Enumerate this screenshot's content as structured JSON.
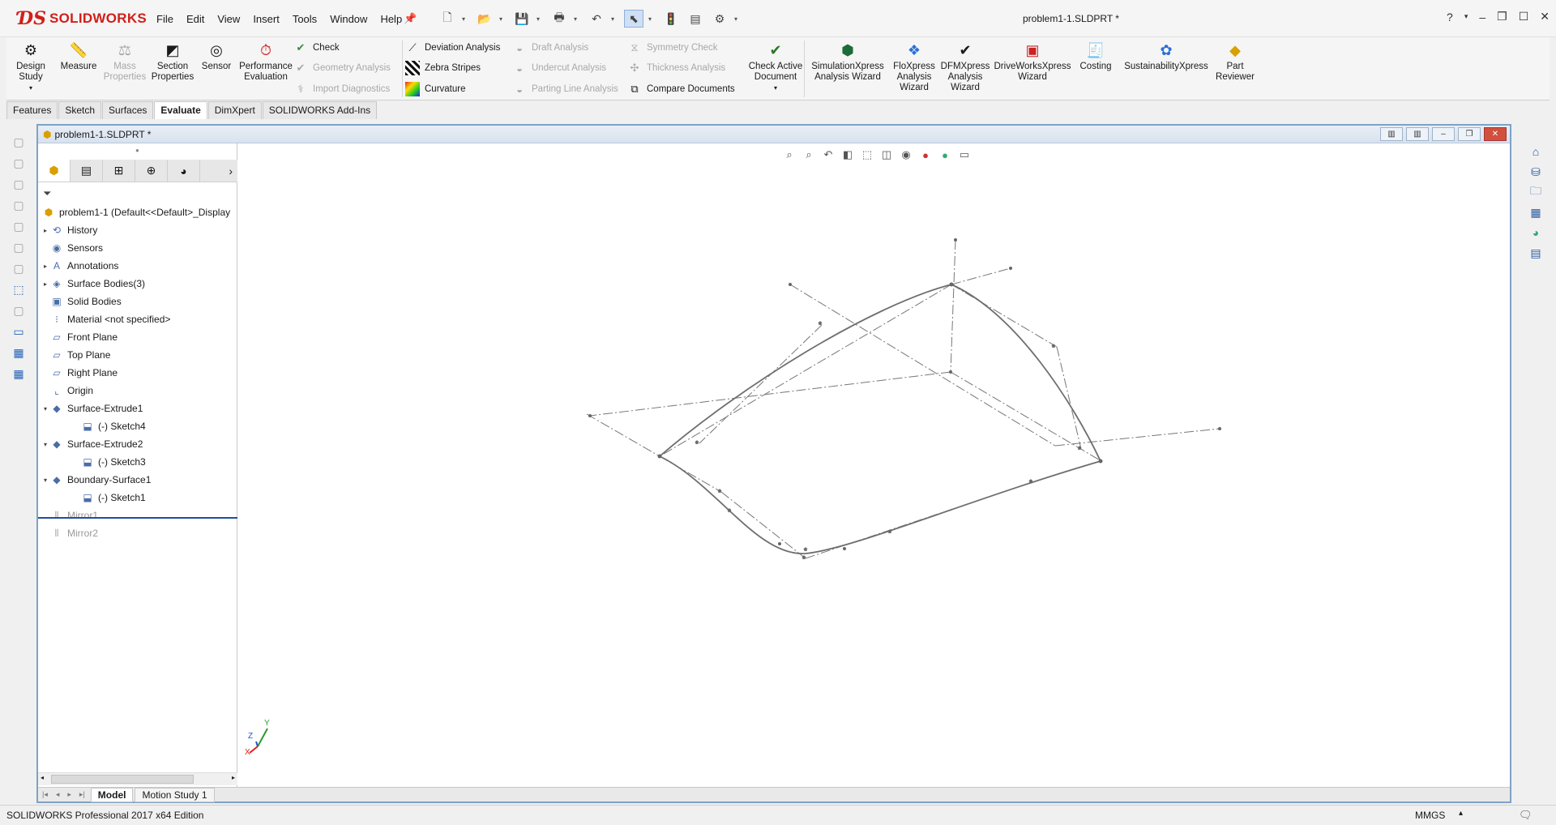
{
  "app": {
    "brand": "SOLIDWORKS",
    "doc_title": "problem1-1.SLDPRT *",
    "menu": [
      "File",
      "Edit",
      "View",
      "Insert",
      "Tools",
      "Window",
      "Help"
    ]
  },
  "ribbon": {
    "design_study": "Design\nStudy",
    "measure": "Measure",
    "mass_properties": "Mass\nProperties",
    "section_properties": "Section\nProperties",
    "sensor": "Sensor",
    "performance_evaluation": "Performance\nEvaluation",
    "check": "Check",
    "geometry_analysis": "Geometry Analysis",
    "import_diagnostics": "Import Diagnostics",
    "deviation_analysis": "Deviation Analysis",
    "zebra_stripes": "Zebra Stripes",
    "curvature": "Curvature",
    "draft_analysis": "Draft Analysis",
    "undercut_analysis": "Undercut Analysis",
    "parting_line_analysis": "Parting Line Analysis",
    "symmetry_check": "Symmetry Check",
    "thickness_analysis": "Thickness Analysis",
    "compare_documents": "Compare Documents",
    "check_active_document": "Check Active\nDocument",
    "simulationxpress": "SimulationXpress\nAnalysis Wizard",
    "floxpress": "FloXpress\nAnalysis\nWizard",
    "dfmxpress": "DFMXpress\nAnalysis\nWizard",
    "driveworksxpress": "DriveWorksXpress\nWizard",
    "costing": "Costing",
    "sustainabilityxpress": "SustainabilityXpress",
    "part_reviewer": "Part\nReviewer"
  },
  "command_tabs": [
    "Features",
    "Sketch",
    "Surfaces",
    "Evaluate",
    "DimXpert",
    "SOLIDWORKS Add-Ins"
  ],
  "active_command_tab": "Evaluate",
  "doc_window": {
    "title": "problem1-1.SLDPRT *"
  },
  "feature_tree": {
    "root": "problem1-1  (Default<<Default>_Display",
    "nodes": [
      {
        "label": "History",
        "expander": "▸",
        "icon": "history-icon"
      },
      {
        "label": "Sensors",
        "expander": "",
        "icon": "sensors-icon"
      },
      {
        "label": "Annotations",
        "expander": "▸",
        "icon": "annotations-icon"
      },
      {
        "label": "Surface Bodies(3)",
        "expander": "▸",
        "icon": "surface-bodies-icon"
      },
      {
        "label": "Solid Bodies",
        "expander": "",
        "icon": "solid-bodies-icon"
      },
      {
        "label": "Material <not specified>",
        "expander": "",
        "icon": "material-icon"
      },
      {
        "label": "Front Plane",
        "expander": "",
        "icon": "plane-icon"
      },
      {
        "label": "Top Plane",
        "expander": "",
        "icon": "plane-icon"
      },
      {
        "label": "Right Plane",
        "expander": "",
        "icon": "plane-icon"
      },
      {
        "label": "Origin",
        "expander": "",
        "icon": "origin-icon"
      },
      {
        "label": "Surface-Extrude1",
        "expander": "▾",
        "icon": "surface-extrude-icon"
      },
      {
        "label": "(-) Sketch4",
        "expander": "",
        "icon": "sketch-icon",
        "indent": true
      },
      {
        "label": "Surface-Extrude2",
        "expander": "▾",
        "icon": "surface-extrude-icon"
      },
      {
        "label": "(-) Sketch3",
        "expander": "",
        "icon": "sketch-icon",
        "indent": true
      },
      {
        "label": "Boundary-Surface1",
        "expander": "▾",
        "icon": "boundary-surface-icon"
      },
      {
        "label": "(-) Sketch1",
        "expander": "",
        "icon": "sketch-icon",
        "indent": true
      },
      {
        "label": "Mirror1",
        "expander": "",
        "icon": "mirror-icon",
        "suppressed": true
      },
      {
        "label": "Mirror2",
        "expander": "",
        "icon": "mirror-icon",
        "suppressed": true
      }
    ]
  },
  "bottom_tabs": [
    "Model",
    "Motion Study 1"
  ],
  "active_bottom_tab": "Model",
  "triad": {
    "y": "Y",
    "z": "Z",
    "x": "X"
  },
  "status_bar": {
    "edition": "SOLIDWORKS Professional 2017 x64 Edition",
    "units": "MMGS"
  },
  "colors": {
    "brand_red": "#d0201a",
    "window_border": "#7ea2c7",
    "rollback_bar": "#1f4ea5"
  }
}
